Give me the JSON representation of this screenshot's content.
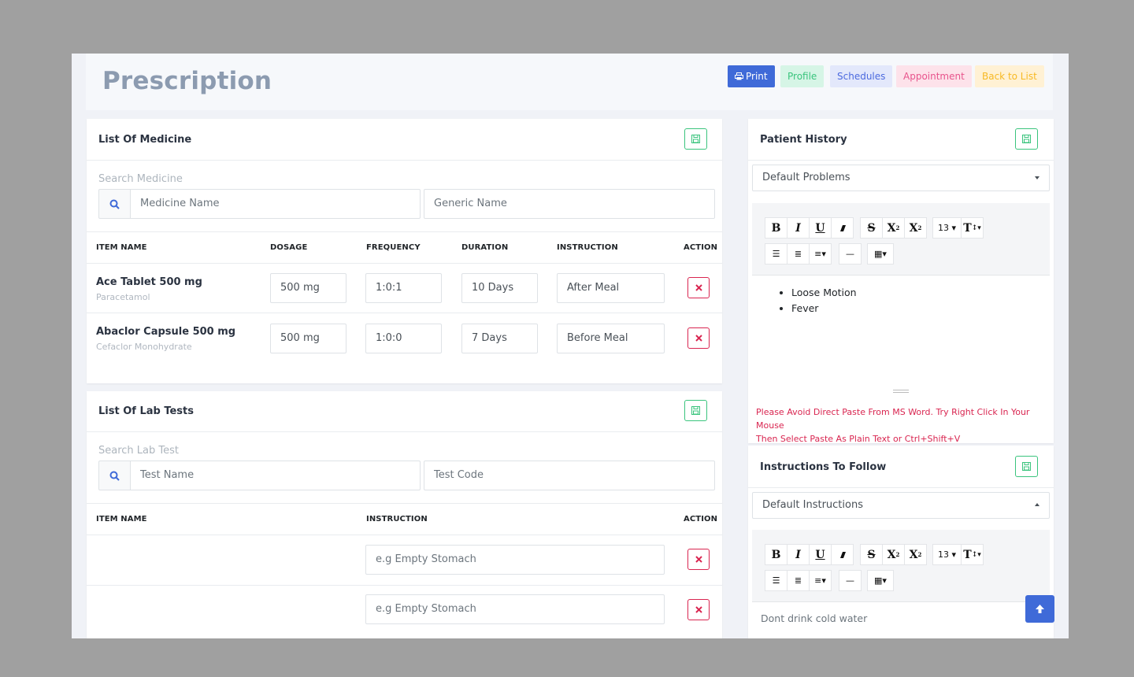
{
  "header": {
    "title": "Prescription",
    "buttons": {
      "print": "Print",
      "profile": "Profile",
      "schedules": "Schedules",
      "appointment": "Appointment",
      "back": "Back to List"
    }
  },
  "medicine": {
    "title": "List Of Medicine",
    "search_label": "Search Medicine",
    "name_placeholder": "Medicine Name",
    "generic_placeholder": "Generic Name",
    "columns": [
      "ITEM NAME",
      "DOSAGE",
      "FREQUENCY",
      "DURATION",
      "INSTRUCTION",
      "ACTION"
    ],
    "rows": [
      {
        "name": "Ace Tablet 500 mg",
        "generic": "Paracetamol",
        "dosage": "500 mg",
        "frequency": "1:0:1",
        "duration": "10 Days",
        "instruction": "After Meal"
      },
      {
        "name": "Abaclor Capsule 500 mg",
        "generic": "Cefaclor Monohydrate",
        "dosage": "500 mg",
        "frequency": "1:0:0",
        "duration": "7 Days",
        "instruction": "Before Meal"
      }
    ]
  },
  "lab": {
    "title": "List Of Lab Tests",
    "search_label": "Search Lab Test",
    "name_placeholder": "Test Name",
    "code_placeholder": "Test Code",
    "columns": [
      "ITEM NAME",
      "INSTRUCTION",
      "ACTION"
    ],
    "rows": [
      {
        "name": "",
        "instruction_placeholder": "e.g Empty Stomach"
      },
      {
        "name": "",
        "instruction_placeholder": "e.g Empty Stomach"
      }
    ]
  },
  "history": {
    "title": "Patient History",
    "select": "Default Problems",
    "font_size": "13",
    "items": [
      "Loose Motion",
      "Fever"
    ],
    "warning_line1": "Please Avoid Direct Paste From MS Word. Try Right Click In Your Mouse",
    "warning_line2": "Then Select Paste As Plain Text or Ctrl+Shift+V"
  },
  "instructions": {
    "title": "Instructions To Follow",
    "select": "Default Instructions",
    "font_size": "13",
    "content": "Dont drink cold water"
  },
  "colors": {
    "primary": "#3f6ad8",
    "success": "#3ac47d",
    "danger": "#d92550",
    "title": "#8c9bb0"
  }
}
